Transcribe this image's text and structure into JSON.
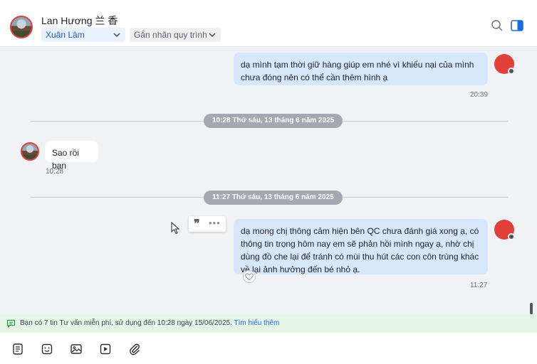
{
  "header": {
    "contact_name": "Lan Hương 兰 香",
    "group_select": "Xuân Lâm",
    "label_select": "Gắn nhãn quy trình"
  },
  "messages": {
    "m1": {
      "text": "dạ mình tạm thời giữ hàng giúp em nhé vì khiếu nại của mình chưa đóng nên có thể cần thêm hình ạ",
      "time": "20:39"
    },
    "divider1": "10:28 Thứ sáu, 13 tháng 6 năm 2025",
    "m2": {
      "text": "Sao rồi bạn",
      "time": "10:28"
    },
    "divider2": "11:27 Thứ sáu, 13 tháng 6 năm 2025",
    "m3": {
      "text": "dạ mong chị thông cảm hiện bên QC chưa đánh giá xong ạ, có thông tin trọng hôm nay em sẽ phản hồi mình ngay ạ, nhờ chị dùng đồ che lại để tránh có mùi thu hút các con côn trùng khác về lại ảnh hưởng đến bé nhỏ ạ.",
      "time": "11:27"
    }
  },
  "quote_actions": {
    "quote": "❞",
    "more": "•••"
  },
  "banner": {
    "text": "Bạn có 7 tin Tư vấn miễn phí, sử dụng đến 10:28 ngày 15/06/2025.",
    "link": "Tìm hiểu thêm"
  },
  "toolbar": {
    "icons": [
      "note-icon",
      "sticker-icon",
      "image-icon",
      "video-icon",
      "attach-icon"
    ]
  },
  "colors": {
    "accent": "#1a6be0",
    "outgoing_bubble": "#d6e6fb",
    "banner_bg": "#e6f6e6",
    "avatar_ring": "#e2403a"
  }
}
